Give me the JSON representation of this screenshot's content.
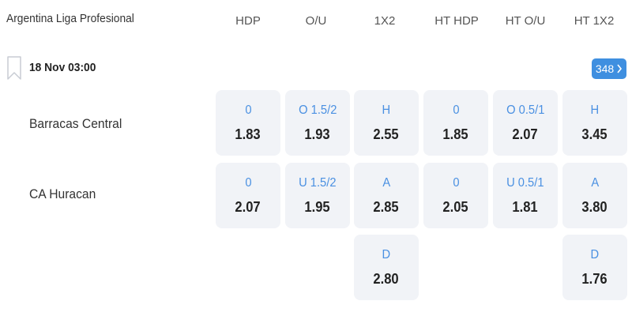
{
  "league": {
    "title": "Argentina Liga Profesional"
  },
  "columns": [
    "HDP",
    "O/U",
    "1X2",
    "HT HDP",
    "HT O/U",
    "HT 1X2"
  ],
  "match": {
    "datetime": "18 Nov  03:00",
    "more_markets": "348",
    "home_team": "Barracas Central",
    "away_team": "CA Huracan"
  },
  "odds": {
    "home": {
      "hdp": {
        "label": "0",
        "odd": "1.83"
      },
      "ou": {
        "label": "O 1.5/2",
        "odd": "1.93"
      },
      "x12": {
        "label": "H",
        "odd": "2.55"
      },
      "hthdp": {
        "label": "0",
        "odd": "1.85"
      },
      "htou": {
        "label": "O 0.5/1",
        "odd": "2.07"
      },
      "htx12": {
        "label": "H",
        "odd": "3.45"
      }
    },
    "away": {
      "hdp": {
        "label": "0",
        "odd": "2.07"
      },
      "ou": {
        "label": "U 1.5/2",
        "odd": "1.95"
      },
      "x12": {
        "label": "A",
        "odd": "2.85"
      },
      "hthdp": {
        "label": "0",
        "odd": "2.05"
      },
      "htou": {
        "label": "U 0.5/1",
        "odd": "1.81"
      },
      "htx12": {
        "label": "A",
        "odd": "3.80"
      }
    },
    "draw": {
      "x12": {
        "label": "D",
        "odd": "2.80"
      },
      "htx12": {
        "label": "D",
        "odd": "1.76"
      }
    }
  },
  "colors": {
    "accent": "#4a90e2",
    "badge": "#3f8fe0",
    "cell_bg": "#f1f3f7"
  },
  "icons": {
    "bookmark": "bookmark-icon",
    "chevron": "chevron-right-icon"
  }
}
